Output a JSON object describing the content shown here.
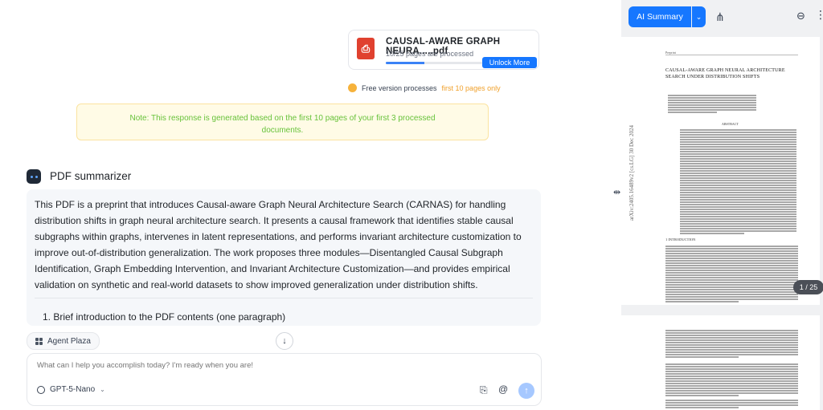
{
  "file_card": {
    "name": "CAUSAL-AWARE GRAPH NEURA.....pdf",
    "pages_processed": "10/25 pages are processed",
    "progress": 0.4,
    "unlock_label": "Unlock More"
  },
  "free_notice": {
    "prefix": "Free version processes",
    "highlight": "first 10 pages only"
  },
  "note": "Note: This response is generated based on the first 10 pages of your first 3 processed documents.",
  "bot": {
    "name": "PDF summarizer"
  },
  "answer": {
    "paragraph": "This PDF is a preprint that introduces Causal-aware Graph Neural Architecture Search (CARNAS) for handling distribution shifts in graph neural architecture search. It presents a causal framework that identifies stable causal subgraphs within graphs, intervenes in latent representations, and performs invariant architecture customization to improve out-of-distribution generalization. The work proposes three modules—Disentangled Causal Subgraph Identification, Graph Embedding Intervention, and Invariant Architecture Customization—and provides empirical validation on synthetic and real-world datasets to show improved generalization under distribution shifts.",
    "list_item": "1. Brief introduction to the PDF contents (one paragraph)"
  },
  "agent_plaza": "Agent Plaza",
  "composer": {
    "placeholder": "What can I help you accomplish today? I'm ready when you are!",
    "model": "GPT-5-Nano"
  },
  "right_panel": {
    "ai_summary_label": "AI Summary",
    "paper_header": "Preprint",
    "paper_title": "CAUSAL-AWARE GRAPH NEURAL ARCHITECTURE SEARCH UNDER DISTRIBUTION SHIFTS",
    "abstract_heading": "ABSTRACT",
    "intro_heading": "1   INTRODUCTION",
    "side_id": "arXiv:2405.16489v2  [cs.LG]  30 Dec 2024",
    "page_indicator": "1 / 25"
  },
  "colors": {
    "accent": "#1677ff",
    "note_bg": "#fffbe6",
    "note_text": "#67c23a",
    "highlight": "#f0a02a",
    "pdf_red": "#e0412f"
  },
  "icons": [
    "pdf-icon",
    "bulb-icon",
    "bot-icon",
    "grid-icon",
    "arrow-down-icon",
    "model-icon",
    "chevron-down-icon",
    "attach-icon",
    "at-icon",
    "send-icon",
    "resize-icon",
    "share-icon",
    "zoom-out-icon",
    "more-icon"
  ]
}
